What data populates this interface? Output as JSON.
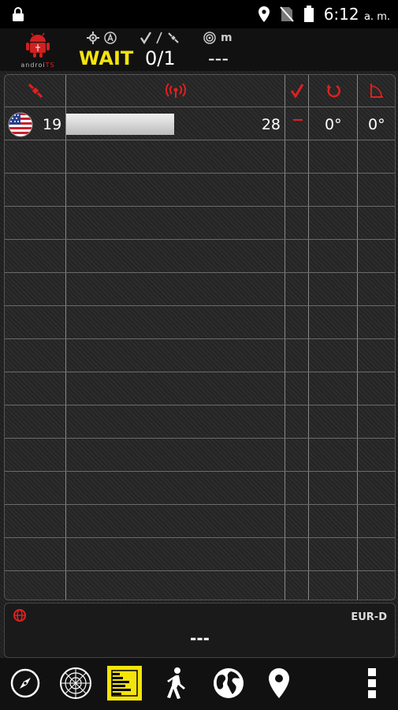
{
  "status_bar": {
    "time": "6:12",
    "ampm": "a. m."
  },
  "header": {
    "logo_text_a": "androi",
    "logo_text_b": "TS",
    "unit": "m",
    "fix_status": "WAIT",
    "sat_count": "0/1",
    "accuracy": "---"
  },
  "satellites": [
    {
      "flag": "US",
      "prn": "19",
      "snr": "28",
      "used": "−",
      "elevation": "0°",
      "azimuth": "0°"
    }
  ],
  "bottom": {
    "datum": "EUR-D",
    "position": "---"
  },
  "colors": {
    "accent": "#e02020",
    "wait": "#f4e40b"
  },
  "nav": [
    "compass-icon",
    "radar-icon",
    "signal-bars-icon",
    "walk-icon",
    "globe-icon",
    "map-pin-icon",
    "more-icon"
  ]
}
